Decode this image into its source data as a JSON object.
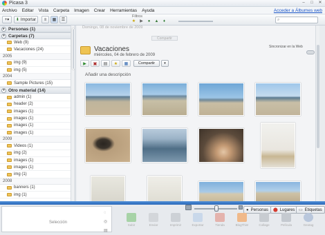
{
  "window": {
    "title": "Picasa 3"
  },
  "menubar": {
    "items": [
      "Archivo",
      "Editar",
      "Vista",
      "Carpeta",
      "Imagen",
      "Crear",
      "Herramientas",
      "Ayuda"
    ],
    "account_link": "Acceder a Álbumes web"
  },
  "toolbar": {
    "import_label": "Importar",
    "filter_label": "Filtros"
  },
  "sidebar": {
    "groups": [
      {
        "label": "Personas (1)"
      },
      {
        "label": "Carpetas (7)"
      },
      {
        "label": "Otro material (14)"
      }
    ],
    "carpetas_items": [
      "Web (9)",
      "Vacaciones (24)"
    ],
    "years": [
      "2005",
      "2004",
      "2009",
      "2008"
    ],
    "y2005_items": [
      "img (9)",
      "img (5)"
    ],
    "y2004_items": [
      "Sample Pictures (15)"
    ],
    "otro_items": [
      "admin (1)",
      "header (2)",
      "images (1)",
      "images (1)",
      "images (1)",
      "images (1)"
    ],
    "y2009_items": [
      "Videos (1)",
      "img (2)",
      "images (1)",
      "images (1)",
      "img (1)"
    ],
    "y2008_items": [
      "banners (1)",
      "img (1)"
    ]
  },
  "main": {
    "prev_album_caption": "Domingo, 08 de noviembre de 2009",
    "prev_actions_label": "Compartir",
    "album_title": "Vacaciones",
    "album_date": "miércoles, 04 de febrero de 2009",
    "sync_label": "Sincronizar en la Web",
    "share_label": "Compartir",
    "add_description": "Añadir una descripción"
  },
  "bottom": {
    "tray_label": "Selección",
    "tabs": {
      "people": "Personas",
      "places": "Lugares",
      "tags": "Etiquetas"
    },
    "actions": [
      "Subir",
      "Enviar",
      "Imprimir",
      "Exportar",
      "Tienda",
      "BlogThis!",
      "Collage",
      "Película",
      "Geotag"
    ]
  },
  "colors": {
    "accent_blue": "#2a68b8",
    "folder_yellow": "#efc453"
  }
}
